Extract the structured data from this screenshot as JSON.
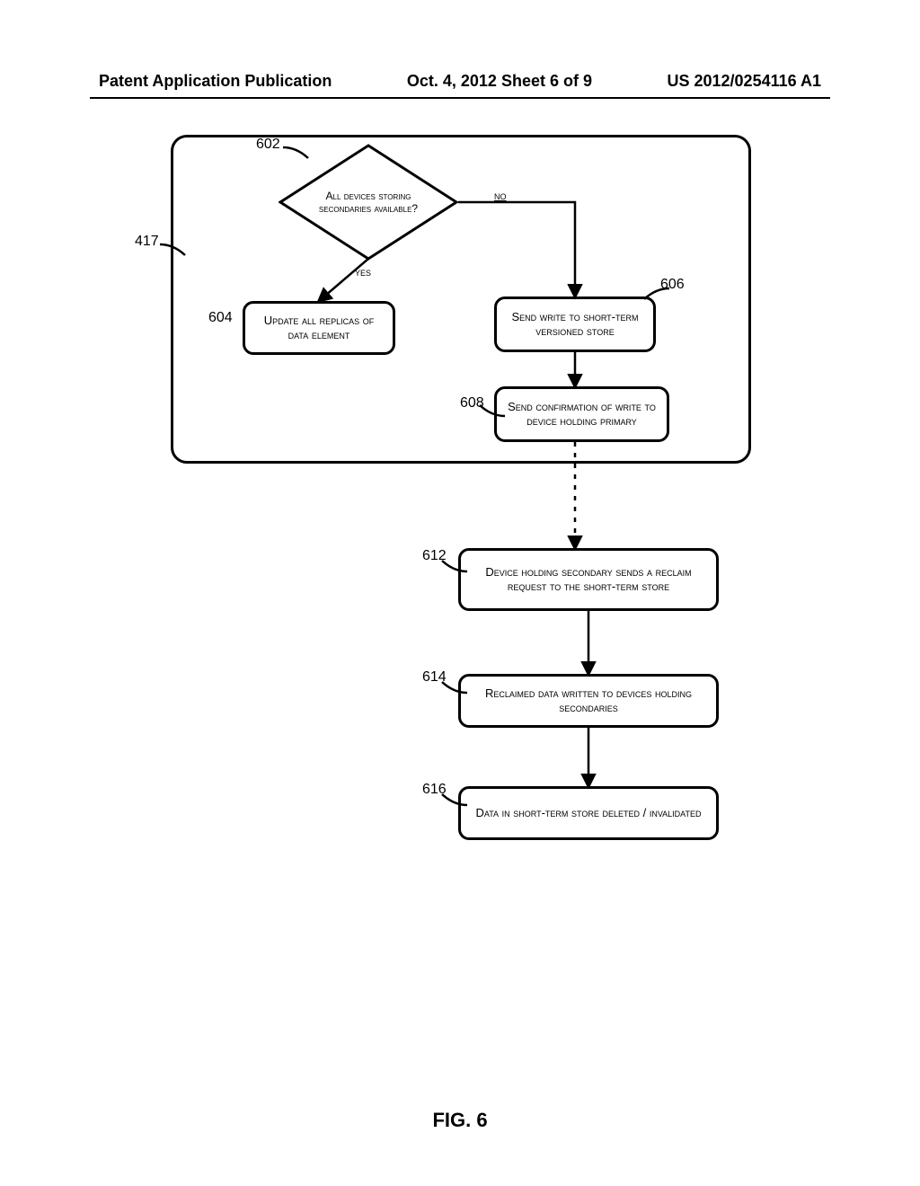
{
  "header": {
    "left": "Patent Application Publication",
    "center": "Oct. 4, 2012  Sheet 6 of 9",
    "right": "US 2012/0254116 A1"
  },
  "figure_label": "FIG. 6",
  "refs": {
    "container": "417",
    "decision": "602",
    "b604": "604",
    "b606": "606",
    "b608": "608",
    "b612": "612",
    "b614": "614",
    "b616": "616"
  },
  "edges": {
    "no": "no",
    "yes": "yes"
  },
  "nodes": {
    "decision": "All devices storing secondaries available?",
    "b604": "Update all replicas of data element",
    "b606": "Send write to short-term versioned store",
    "b608": "Send confirmation of write to device holding primary",
    "b612": "Device holding secondary sends a reclaim request to the short-term store",
    "b614": "Reclaimed data written to devices holding secondaries",
    "b616": "Data in short-term store deleted / invalidated"
  }
}
